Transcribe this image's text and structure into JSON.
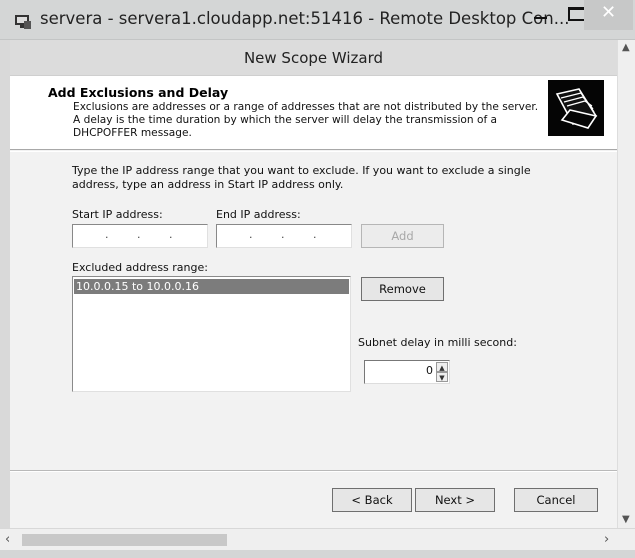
{
  "rdp": {
    "title": "servera - servera1.cloudapp.net:51416 - Remote Desktop Con...",
    "close_glyph": "✕"
  },
  "wizard": {
    "title": "New Scope Wizard",
    "header": {
      "title": "Add Exclusions and Delay",
      "description": "Exclusions are addresses or a range of addresses that are not distributed by the server. A delay is the time duration by which the server will delay the transmission of a DHCPOFFER message."
    },
    "instruction": "Type the IP address range that you want to exclude. If you want to exclude a single address, type an address in Start IP address only.",
    "start_ip_label": "Start IP address:",
    "end_ip_label": "End IP address:",
    "add_label": "Add",
    "excluded_label": "Excluded address range:",
    "excluded_items": [
      "10.0.0.15 to 10.0.0.16"
    ],
    "remove_label": "Remove",
    "delay_label": "Subnet delay in milli second:",
    "delay_value": "0",
    "back_label": "< Back",
    "next_label": "Next >",
    "cancel_label": "Cancel"
  },
  "icons": {
    "app": "remote-desktop-icon",
    "header": "documents-folder-icon"
  },
  "colors": {
    "selection": "#7c7c7c",
    "header_icon_bg": "#050505"
  }
}
